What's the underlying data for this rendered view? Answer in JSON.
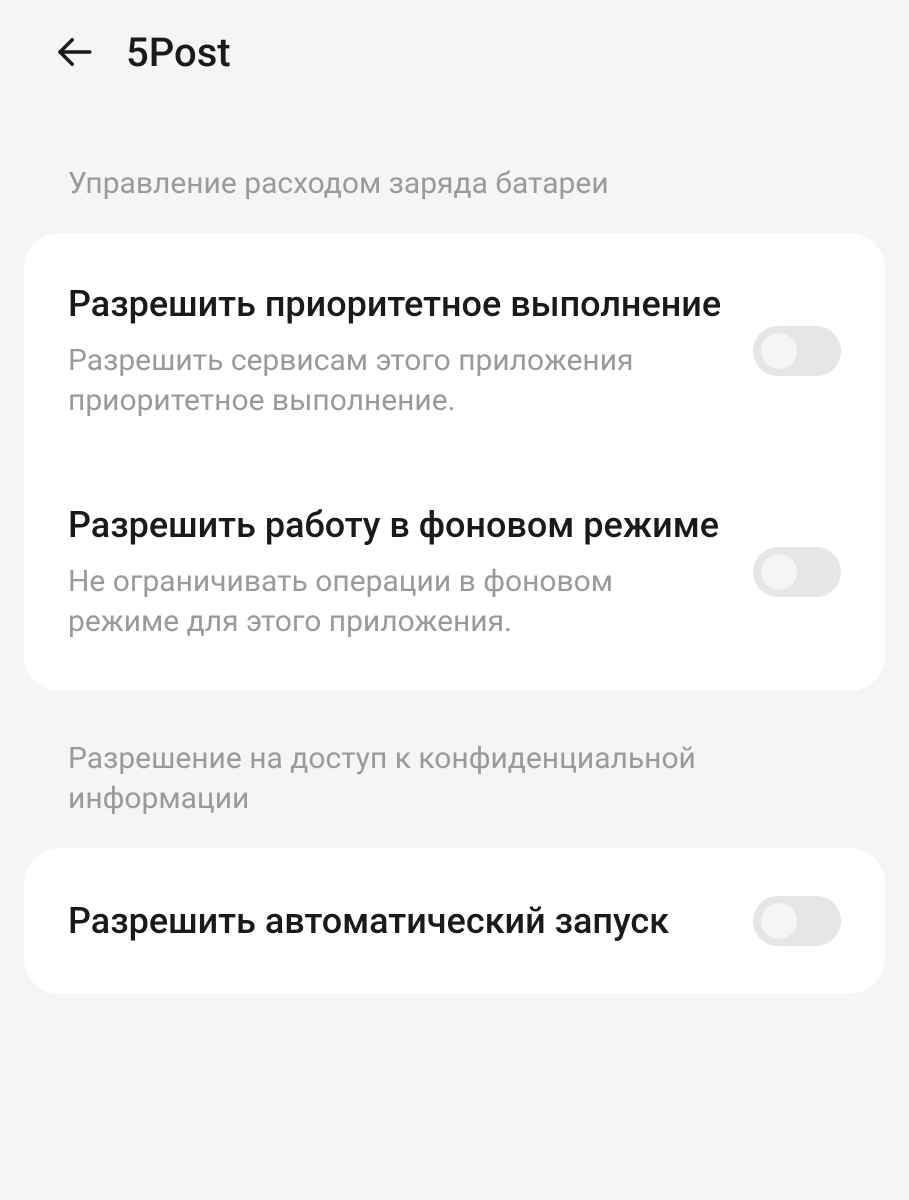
{
  "header": {
    "title": "5Post"
  },
  "sections": {
    "battery": {
      "label": "Управление расходом заряда батареи",
      "items": [
        {
          "title": "Разрешить приоритетное выполнение",
          "desc": "Разрешить сервисам этого приложения приоритетное выполнение."
        },
        {
          "title": "Разрешить работу в фоновом режиме",
          "desc": "Не ограничивать операции в фоновом режиме для этого приложения."
        }
      ]
    },
    "privacy": {
      "label": "Разрешение на доступ к конфиденциальной информации",
      "items": [
        {
          "title": "Разрешить автоматический запуск"
        }
      ]
    }
  }
}
